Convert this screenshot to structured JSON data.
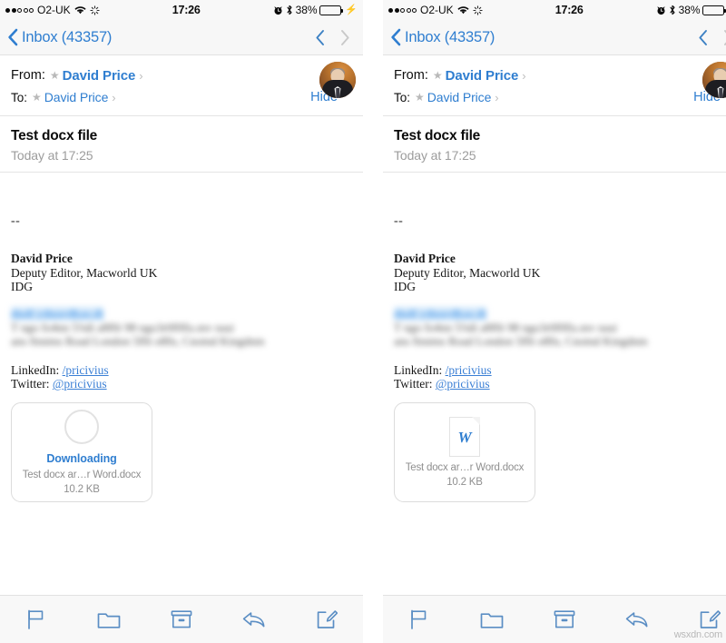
{
  "device": {
    "status_bar": {
      "signal_dots": {
        "filled": 2,
        "total": 5
      },
      "carrier": "O2-UK",
      "wifi_icon": "wifi-icon",
      "activity_icon": "activity-spinner-icon",
      "time": "17:26",
      "alarm_icon": "alarm-clock-icon",
      "bluetooth_icon": "bluetooth-icon",
      "battery_percent": "38%",
      "battery_level": 38,
      "charging_icon": "lightning-bolt-icon",
      "battery_color": "#4cd04c"
    },
    "nav_bar": {
      "back_icon": "chevron-left-icon",
      "back_label": "Inbox (43357)",
      "prev_message_icon": "chevron-up-icon",
      "next_message_icon": "chevron-down-icon",
      "prev_enabled": true,
      "next_enabled": false
    }
  },
  "message": {
    "from_label": "From:",
    "from_name": "David Price",
    "to_label": "To:",
    "to_name": "David Price",
    "star_icon": "star-icon",
    "disclosure_icon": "chevron-right-icon",
    "hide_label": "Hide",
    "avatar": "contact-avatar",
    "subject": "Test docx file",
    "datetime": "Today at 17:25",
    "signature": {
      "separator": "--",
      "name": "David Price",
      "title": "Deputy Editor, Macworld UK",
      "company": "IDG",
      "redacted_lines": [
        "dndi  ydnordkas.di",
        "T  ngo fo4nn 5!tdi a8f0i  98   ngo3r0f0fis.mv nasi",
        "ans ftnntns Road  London 5f0i  o8fn, Cnotnd Kingdnm"
      ],
      "linkedin_label": "LinkedIn:",
      "linkedin_handle": "/pricivius",
      "twitter_label": "Twitter:",
      "twitter_handle": "@pricivius"
    }
  },
  "attachment_left": {
    "state_icon": "download-progress-ring-icon",
    "status": "Downloading",
    "filename": "Test docx ar…r Word.docx",
    "size": "10.2 KB"
  },
  "attachment_right": {
    "state_icon": "word-document-icon",
    "icon_letter": "W",
    "filename": "Test docx ar…r Word.docx",
    "size": "10.2 KB"
  },
  "toolbar": {
    "flag_icon": "flag-icon",
    "move_icon": "folder-icon",
    "archive_icon": "archive-box-icon",
    "reply_icon": "reply-arrow-icon",
    "compose_icon": "compose-icon"
  },
  "colors": {
    "accent_blue": "#2f7ed0",
    "toolbar_icon_blue": "#5b8ec4",
    "chrome_gray": "#f7f7f7",
    "muted_text": "#9c9c9c"
  },
  "watermark": "wsxdn.com"
}
